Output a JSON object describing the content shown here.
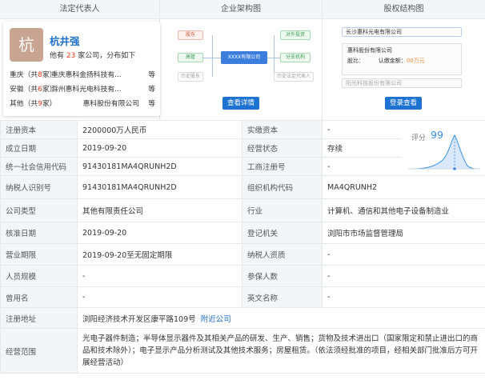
{
  "headers": {
    "legal_rep": "法定代表人",
    "org_chart": "企业架构图",
    "equity": "股权结构图"
  },
  "rep": {
    "avatar_char": "杭",
    "name": "杭井强",
    "sub_prefix": "他有",
    "sub_count": "23",
    "sub_suffix": "家公司，分布如下",
    "rows": [
      {
        "region": "重庆",
        "count": "8",
        "company": "重庆惠科金扬科技有...",
        "more": "等"
      },
      {
        "region": "安徽",
        "count": "6",
        "company": "滁州惠科光电科技有...",
        "more": "等"
      },
      {
        "region": "其他",
        "count": "9",
        "company": "惠科股份有限公司",
        "more": "等"
      }
    ]
  },
  "org": {
    "shareholder": "股东",
    "exec": "高管",
    "history_legal": "历史股东",
    "main": "XXXX有限公司",
    "investment": "对外投资",
    "branch": "分支机构",
    "history_rep": "历史法定代表人",
    "button": "查看详情"
  },
  "equity": {
    "company_top": "长沙惠科光电有限公司",
    "holder": "惠科股份有限公司",
    "ratio_label": "股比：",
    "amount_label": "认缴金额：",
    "amount": "00万元",
    "company_bottom": "阳光科技股份有限公司",
    "button": "登录查看"
  },
  "score": {
    "label": "评分",
    "value": "99"
  },
  "info": {
    "reg_capital_l": "注册资本",
    "reg_capital_v": "2200000万人民币",
    "paid_capital_l": "实缴资本",
    "paid_capital_v": "-",
    "est_date_l": "成立日期",
    "est_date_v": "2019-09-20",
    "status_l": "经营状态",
    "status_v": "存续",
    "credit_code_l": "统一社会信用代码",
    "credit_code_v": "91430181MA4QRUNH2D",
    "biz_reg_no_l": "工商注册号",
    "biz_reg_no_v": "-",
    "taxpayer_id_l": "纳税人识别号",
    "taxpayer_id_v": "91430181MA4QRUNH2D",
    "org_code_l": "组织机构代码",
    "org_code_v": "MA4QRUNH2",
    "company_type_l": "公司类型",
    "company_type_v": "其他有限责任公司",
    "industry_l": "行业",
    "industry_v": "计算机、通信和其他电子设备制造业",
    "approve_date_l": "核准日期",
    "approve_date_v": "2019-09-20",
    "reg_authority_l": "登记机关",
    "reg_authority_v": "浏阳市市场监督管理局",
    "biz_term_l": "营业期限",
    "biz_term_v": "2019-09-20至无固定期限",
    "taxpayer_qual_l": "纳税人资质",
    "taxpayer_qual_v": "-",
    "staff_l": "人员规模",
    "staff_v": "-",
    "insured_l": "参保人数",
    "insured_v": "-",
    "former_name_l": "曾用名",
    "former_name_v": "-",
    "en_name_l": "英文名称",
    "en_name_v": "-",
    "address_l": "注册地址",
    "address_v": "浏阳经济技术开发区康平路109号",
    "nearby": "附近公司",
    "scope_l": "经营范围",
    "scope_v": "光电子器件制造；半导体显示器件及其相关产品的研发、生产、销售；货物及技术进出口（国家限定和禁止进出口的商品和技术除外）；电子显示产品分析测试及其他技术服务；房屋租赁。（依法须经批准的项目，经相关部门批准后方可开展经营活动）"
  }
}
